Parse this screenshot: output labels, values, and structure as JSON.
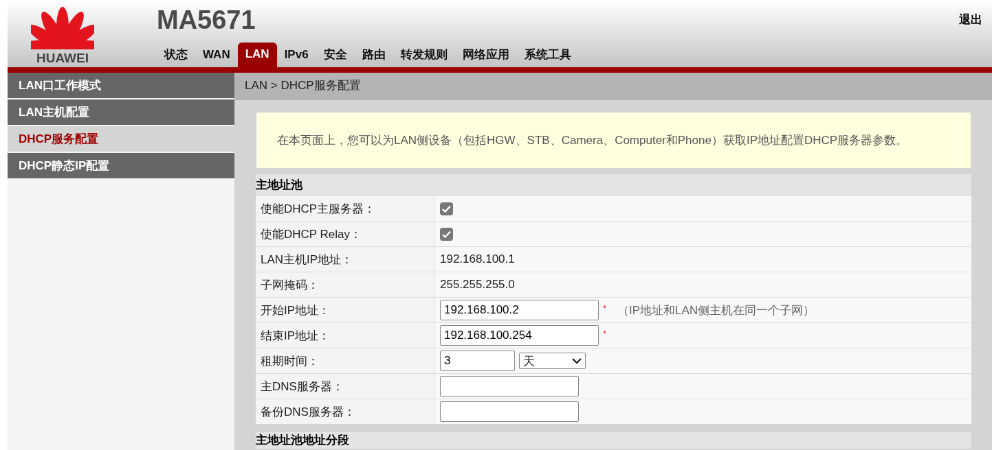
{
  "header": {
    "logo_text": "HUAWEI",
    "model": "MA5671",
    "logout": "退出"
  },
  "tabs": [
    {
      "label": "状态",
      "selected": false
    },
    {
      "label": "WAN",
      "selected": false
    },
    {
      "label": "LAN",
      "selected": true
    },
    {
      "label": "IPv6",
      "selected": false
    },
    {
      "label": "安全",
      "selected": false
    },
    {
      "label": "路由",
      "selected": false
    },
    {
      "label": "转发规则",
      "selected": false
    },
    {
      "label": "网络应用",
      "selected": false
    },
    {
      "label": "系统工具",
      "selected": false
    }
  ],
  "sidebar": {
    "items": [
      {
        "label": "LAN口工作模式",
        "selected": false
      },
      {
        "label": "LAN主机配置",
        "selected": false
      },
      {
        "label": "DHCP服务配置",
        "selected": true
      },
      {
        "label": "DHCP静态IP配置",
        "selected": false
      }
    ]
  },
  "breadcrumb": "LAN > DHCP服务配置",
  "info": "在本页面上，您可以为LAN侧设备（包括HGW、STB、Camera、Computer和Phone）获取IP地址配置DHCP服务器参数。",
  "sections": [
    {
      "title": "主地址池",
      "rows": [
        {
          "kind": "checkbox",
          "label": "使能DHCP主服务器：",
          "checked": true
        },
        {
          "kind": "checkbox",
          "label": "使能DHCP Relay：",
          "checked": true
        },
        {
          "kind": "text",
          "label": "LAN主机IP地址：",
          "value": "192.168.100.1"
        },
        {
          "kind": "text",
          "label": "子网掩码：",
          "value": "255.255.255.0"
        },
        {
          "kind": "input",
          "label": "开始IP地址：",
          "value": "192.168.100.2",
          "required": true,
          "hint": "（IP地址和LAN侧主机在同一个子网）"
        },
        {
          "kind": "input",
          "label": "结束IP地址：",
          "value": "192.168.100.254",
          "required": true
        },
        {
          "kind": "lease",
          "label": "租期时间：",
          "value": "3",
          "unit": "天"
        },
        {
          "kind": "short-input",
          "label": "主DNS服务器："
        },
        {
          "kind": "short-input",
          "label": "备份DNS服务器："
        }
      ]
    },
    {
      "title": "主地址池地址分段"
    }
  ],
  "required_mark": "*"
}
